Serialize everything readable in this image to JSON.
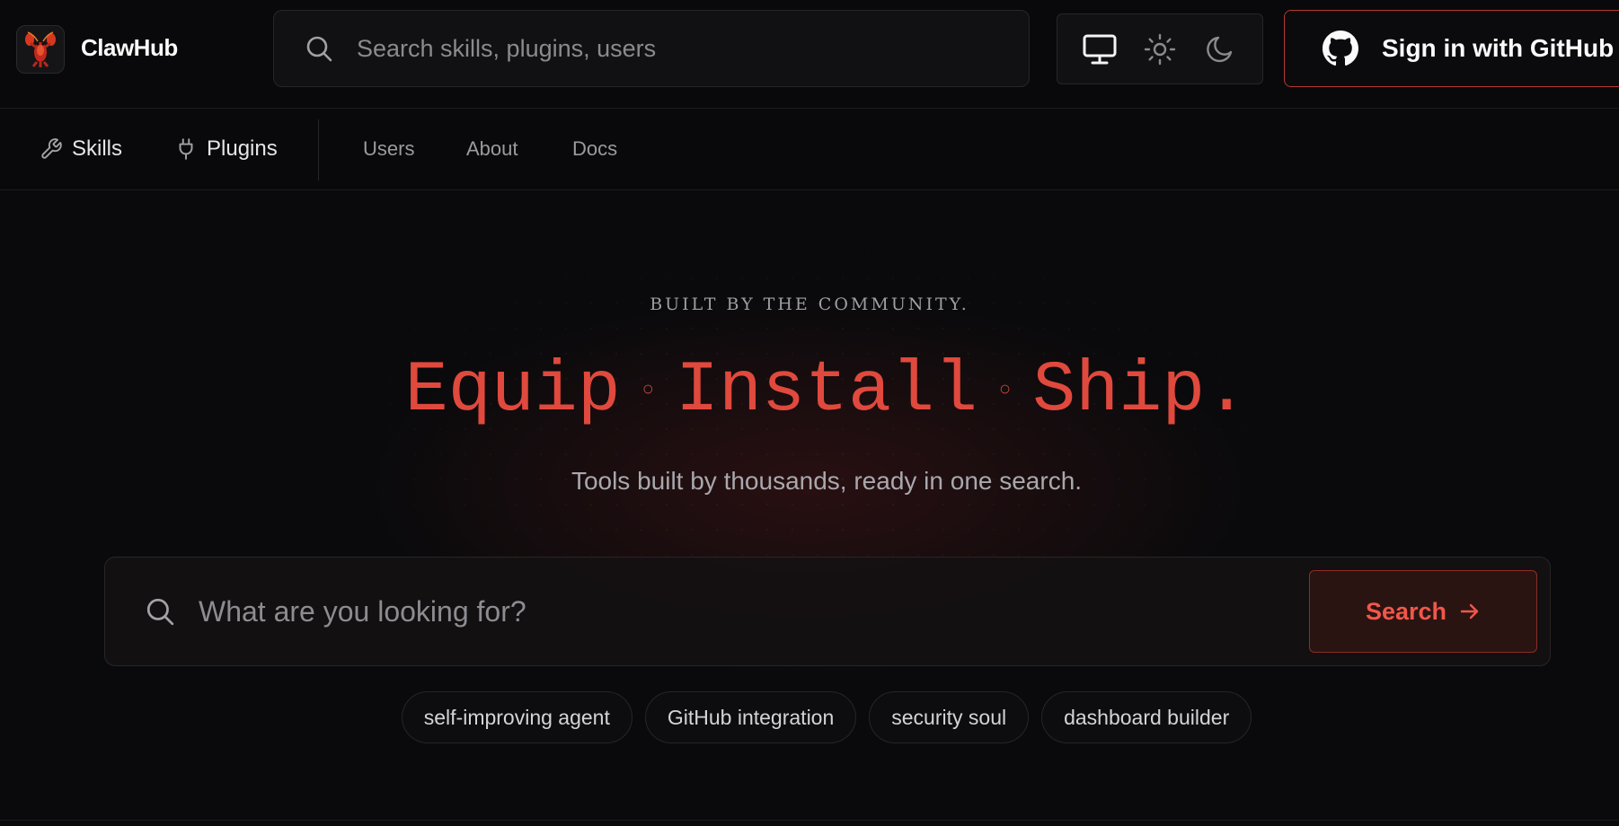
{
  "header": {
    "brand": "ClawHub",
    "search_placeholder": "Search skills, plugins, users",
    "theme_options": [
      "monitor-icon",
      "sun-icon",
      "moon-icon"
    ],
    "signin_label": "Sign in with GitHub"
  },
  "nav": {
    "primary": [
      {
        "label": "Skills",
        "icon": "wrench-icon"
      },
      {
        "label": "Plugins",
        "icon": "plug-icon"
      }
    ],
    "secondary": [
      "Users",
      "About",
      "Docs"
    ]
  },
  "hero": {
    "eyebrow": "BUILT BY THE COMMUNITY.",
    "headline": [
      "Equip",
      "Install",
      "Ship."
    ],
    "subtitle": "Tools built by thousands, ready in one search.",
    "search_placeholder": "What are you looking for?",
    "search_button": "Search",
    "chips": [
      "self-improving agent",
      "GitHub integration",
      "security soul",
      "dashboard builder"
    ]
  },
  "colors": {
    "accent": "#e0493d",
    "background": "#09090b",
    "signin_border": "#b8372e"
  }
}
